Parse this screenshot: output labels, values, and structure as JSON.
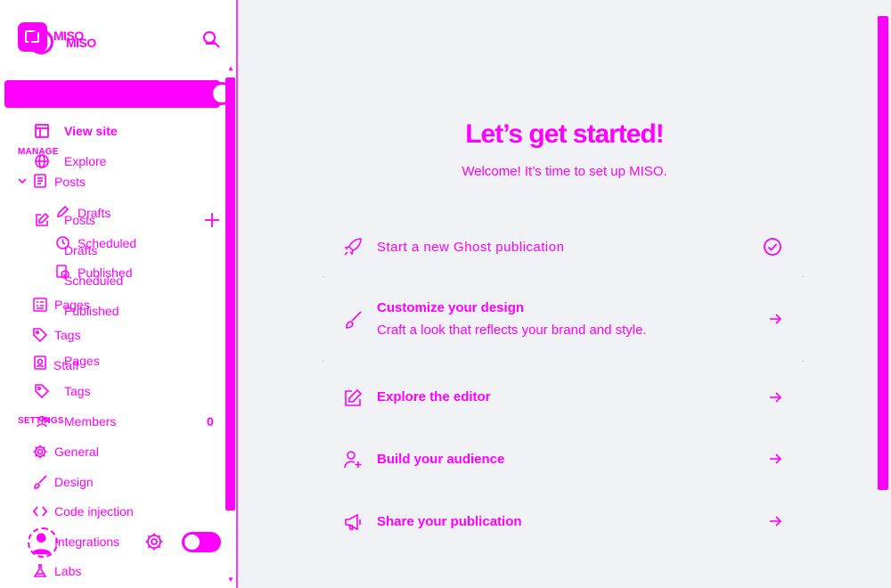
{
  "brand": {
    "name": "MISO",
    "name_echo": "MISO"
  },
  "colors": {
    "accent": "#ff00ff",
    "main_bg": "#f1f2f6",
    "sidebar_bg": "#ffffff"
  },
  "sidebar": {
    "search_icon": "search-icon",
    "top_links": [
      {
        "label": "View site",
        "icon": "window-icon"
      },
      {
        "label": "Explore",
        "icon": "globe-icon"
      }
    ],
    "manage_label": "MANAGE",
    "posts": {
      "label": "Posts",
      "label_echo": "Posts",
      "icon": "posts-icon",
      "sub_items": [
        {
          "label": "Drafts",
          "echo": "Drafts"
        },
        {
          "label": "Scheduled",
          "echo": "Scheduled"
        },
        {
          "label": "Published",
          "echo": "Published"
        }
      ]
    },
    "pages": {
      "label": "Pages",
      "echo": "Pages"
    },
    "tags": {
      "label": "Tags",
      "echo": "Tags"
    },
    "staff": {
      "label": "Staff"
    },
    "members": {
      "label": "Members",
      "count": "0"
    },
    "settings_label": "SETTINGS",
    "settings_items": [
      {
        "label": "General",
        "icon": "gear-icon"
      },
      {
        "label": "Design",
        "icon": "brush-icon"
      },
      {
        "label": "Code injection",
        "icon": "code-icon"
      },
      {
        "label": "Integrations",
        "icon": "integrations-icon"
      },
      {
        "label": "Labs",
        "icon": "flask-icon"
      }
    ]
  },
  "main": {
    "title": "Let’s get started!",
    "subtitle": "Welcome! It’s time to set up MISO.",
    "steps": [
      {
        "title": "Start a new Ghost publication",
        "status": "completed",
        "icon": "rocket-icon"
      },
      {
        "title": "Customize your design",
        "description": "Craft a look that reflects your brand and style.",
        "icon": "brush-icon"
      },
      {
        "title": "Explore the editor",
        "icon": "edit-icon"
      },
      {
        "title": "Build your audience",
        "icon": "add-user-icon"
      },
      {
        "title": "Share your publication",
        "icon": "megaphone-icon"
      }
    ]
  }
}
